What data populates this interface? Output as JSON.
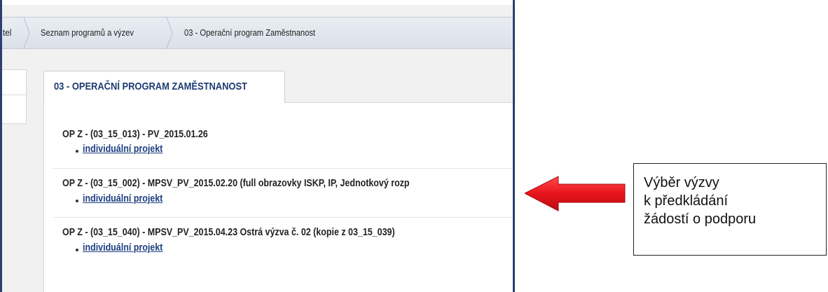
{
  "breadcrumb": {
    "items": [
      {
        "label": "tel"
      },
      {
        "label": "Seznam programů a výzev"
      },
      {
        "label": "03 - Operační program Zaměstnanost"
      }
    ]
  },
  "program_tab": {
    "title": "03 - OPERAČNÍ PROGRAM ZAMĚSTNANOST"
  },
  "calls": [
    {
      "title": "OP Z - (03_15_013) - PV_2015.01.26",
      "link": "individuální projekt"
    },
    {
      "title": "OP Z - (03_15_002) - MPSV_PV_2015.02.20 (full obrazovky ISKP, IP, Jednotkový rozp",
      "link": "individuální projekt"
    },
    {
      "title": "OP Z - (03_15_040) - MPSV_PV_2015.04.23 Ostrá výzva č. 02 (kopie z 03_15_039)",
      "link": "individuální projekt"
    }
  ],
  "annotation": {
    "arrow_color": "#e8141c",
    "lines": [
      "Výběr výzvy",
      "k předkládání",
      "žádostí o podporu"
    ]
  }
}
